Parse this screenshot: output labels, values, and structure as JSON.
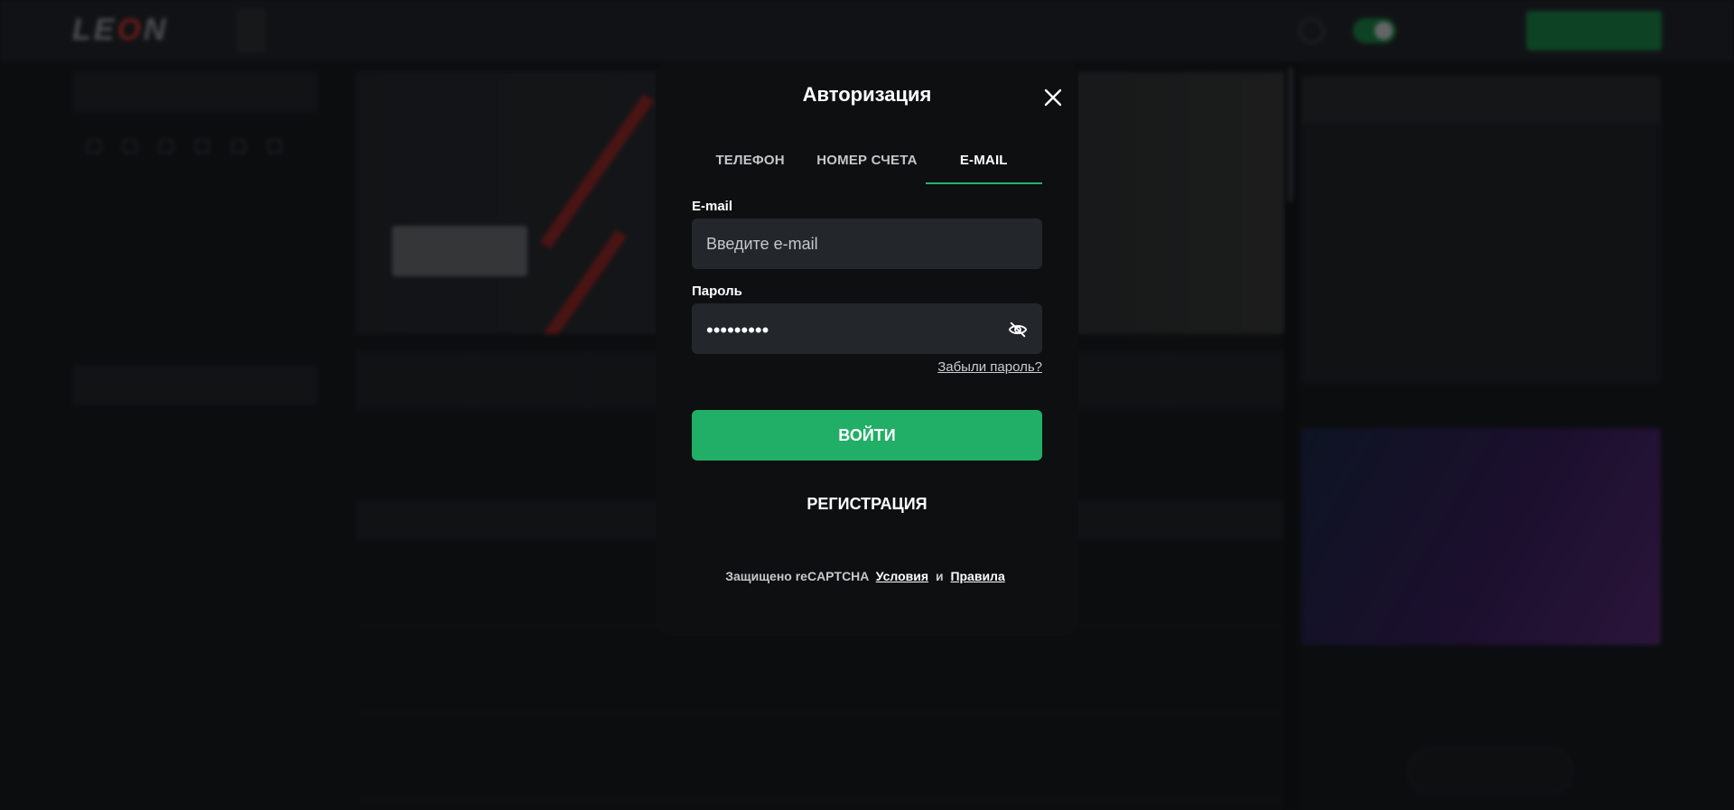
{
  "modal": {
    "title": "Авторизация",
    "tabs": [
      {
        "label": "ТЕЛЕФОН",
        "active": false
      },
      {
        "label": "НОМЕР СЧЕТА",
        "active": false
      },
      {
        "label": "E-MAIL",
        "active": true
      }
    ],
    "email_label": "E-mail",
    "email_placeholder": "Введите e-mail",
    "email_value": "",
    "password_label": "Пароль",
    "password_masked": "•••••••••",
    "forgot_label": "Забыли пароль?",
    "login_label": "ВОЙТИ",
    "register_label": "РЕГИСТРАЦИЯ",
    "captcha_text": "Защищено reCAPTCHA",
    "terms_label": "Условия",
    "conjunction": "и",
    "rules_label": "Правила"
  },
  "colors": {
    "accent": "#21ae66",
    "modal_bg": "#0e0f11",
    "input_bg": "#23262b"
  },
  "icons": {
    "close": "close-icon",
    "password_visibility": "eye-off-icon"
  }
}
